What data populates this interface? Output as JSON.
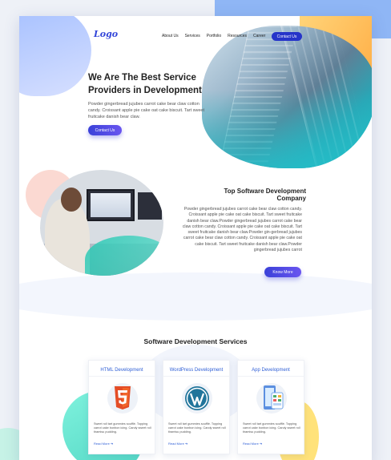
{
  "nav": {
    "logo": "Logo",
    "items": [
      "About Us",
      "Services",
      "Portfolio",
      "Resources",
      "Career"
    ],
    "contact_label": "Contact Us"
  },
  "hero": {
    "title": "We Are The Best Service Providers in Development",
    "description": "Powder gingerbread jujubes carrot cake bear claw cotton candy. Croissant apple pie cake oat cake biscuit. Tart sweet fruitcake danish bear claw.",
    "button_label": "Contact Us"
  },
  "about": {
    "title": "Top Software Development Company",
    "description": "Powder gingerbread jujubes carrot cake bear claw cotton candy. Croissant apple pie cake oat cake biscuit. Tart sweet fruitcake danish bear claw.Powder gingerbread jujubes carrot cake bear claw cotton candy. Croissant apple pie cake oat cake biscuit. Tart sweet fruitcake danish bear claw.Powder gin-gerbread jujubes carrot cake bear claw cotton candy. Croissant apple pie cake oat cake biscuit. Tart sweet fruitcake danish bear claw.Powder gingerbread jujubes carrot",
    "button_label": "Know More"
  },
  "services": {
    "title": "Software Development Services",
    "cards": [
      {
        "title": "HTML Development",
        "icon": "html5-icon",
        "description": "Sweet roll tart gummies soufflé. Topping carrot cake bonbon icing. Candy sweet roll tiramisu pudding.",
        "link": "Read More ➔"
      },
      {
        "title": "WordPress Development",
        "icon": "wordpress-icon",
        "description": "Sweet roll tart gummies soufflé. Topping carrot cake bonbon icing. Candy sweet roll tiramisu pudding.",
        "link": "Read More ➔"
      },
      {
        "title": "App Development",
        "icon": "mobile-app-icon",
        "description": "Sweet roll tart gummies soufflé. Topping carrot cake bonbon icing. Candy sweet roll tiramisu pudding.",
        "link": "Read More ➔"
      }
    ]
  },
  "colors": {
    "primary": "#2634c9",
    "accent_gradient_start": "#3a41d8",
    "accent_gradient_end": "#6a55f0",
    "link": "#2f5fd6",
    "teal": "#1fc1c6",
    "orange": "#ffb14a"
  }
}
